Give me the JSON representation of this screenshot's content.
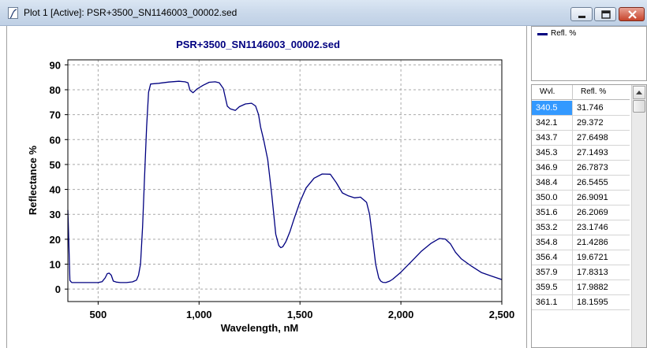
{
  "window": {
    "title": "Plot 1 [Active]: PSR+3500_SN1146003_00002.sed",
    "icon": "plot-icon",
    "buttons": [
      "minimize-icon",
      "maximize-icon",
      "close-icon"
    ]
  },
  "legend": {
    "label": "Refl. %",
    "color": "#000080"
  },
  "table": {
    "headers": [
      "Wvl.",
      "Refl. %"
    ],
    "selected_row": 0,
    "selected_color": "#3399ff",
    "rows": [
      [
        "340.5",
        "31.746"
      ],
      [
        "342.1",
        "29.372"
      ],
      [
        "343.7",
        "27.6498"
      ],
      [
        "345.3",
        "27.1493"
      ],
      [
        "346.9",
        "26.7873"
      ],
      [
        "348.4",
        "26.5455"
      ],
      [
        "350.0",
        "26.9091"
      ],
      [
        "351.6",
        "26.2069"
      ],
      [
        "353.2",
        "23.1746"
      ],
      [
        "354.8",
        "21.4286"
      ],
      [
        "356.4",
        "19.6721"
      ],
      [
        "357.9",
        "17.8313"
      ],
      [
        "359.5",
        "17.9882"
      ],
      [
        "361.1",
        "18.1595"
      ]
    ]
  },
  "chart_data": {
    "type": "line",
    "title": "PSR+3500_SN1146003_00002.sed",
    "xlabel": "Wavelength, nM",
    "ylabel": "Reflectance %",
    "xlim": [
      350,
      2500
    ],
    "ylim": [
      -5,
      92
    ],
    "x_ticks": [
      500,
      1000,
      1500,
      2000,
      2500
    ],
    "x_tick_labels": [
      "500",
      "1,000",
      "1,500",
      "2,000",
      "2,500"
    ],
    "y_ticks": [
      0,
      10,
      20,
      30,
      40,
      50,
      60,
      70,
      80,
      90
    ],
    "y_tick_labels": [
      "0",
      "10",
      "20",
      "30",
      "40",
      "50",
      "60",
      "70",
      "80",
      "90"
    ],
    "grid": true,
    "series": [
      {
        "name": "Refl. %",
        "color": "#000080",
        "x": [
          350,
          352,
          355,
          360,
          365,
          370,
          400,
          450,
          500,
          520,
          535,
          545,
          555,
          565,
          575,
          590,
          610,
          640,
          670,
          690,
          700,
          710,
          720,
          730,
          740,
          750,
          760,
          800,
          850,
          900,
          930,
          945,
          955,
          970,
          990,
          1020,
          1050,
          1080,
          1100,
          1120,
          1130,
          1140,
          1155,
          1180,
          1200,
          1230,
          1260,
          1280,
          1295,
          1305,
          1320,
          1340,
          1360,
          1380,
          1395,
          1405,
          1415,
          1430,
          1450,
          1470,
          1500,
          1530,
          1570,
          1610,
          1650,
          1680,
          1710,
          1740,
          1770,
          1800,
          1830,
          1845,
          1860,
          1875,
          1890,
          1900,
          1910,
          1925,
          1945,
          1960,
          2000,
          2050,
          2100,
          2150,
          2190,
          2220,
          2245,
          2270,
          2300,
          2350,
          2400,
          2450,
          2500
        ],
        "y": [
          31.7,
          26.9,
          17.8,
          3.5,
          3,
          2.6,
          2.6,
          2.6,
          2.6,
          3,
          4.5,
          6.2,
          6.4,
          5.6,
          3.2,
          2.8,
          2.6,
          2.6,
          2.9,
          3.6,
          5.5,
          10,
          25,
          45,
          65,
          79,
          82.3,
          82.6,
          83.1,
          83.4,
          83.2,
          82.8,
          79.8,
          78.8,
          80.3,
          81.8,
          83,
          83.2,
          82.8,
          80.5,
          77,
          73.4,
          72.3,
          71.7,
          73.2,
          74.3,
          74.6,
          73.5,
          70,
          65,
          60,
          52,
          38,
          22,
          17.5,
          16.6,
          17,
          19,
          23,
          28,
          35,
          40.6,
          44.5,
          46.2,
          46.1,
          42.7,
          38.6,
          37.4,
          36.6,
          36.9,
          34.8,
          30,
          20,
          10,
          4.5,
          3.2,
          2.7,
          2.6,
          3.2,
          4,
          6.8,
          10.9,
          15.1,
          18.4,
          20.3,
          20.1,
          18.2,
          14.8,
          12.1,
          9.2,
          6.6,
          5.2,
          3.8
        ]
      }
    ]
  }
}
